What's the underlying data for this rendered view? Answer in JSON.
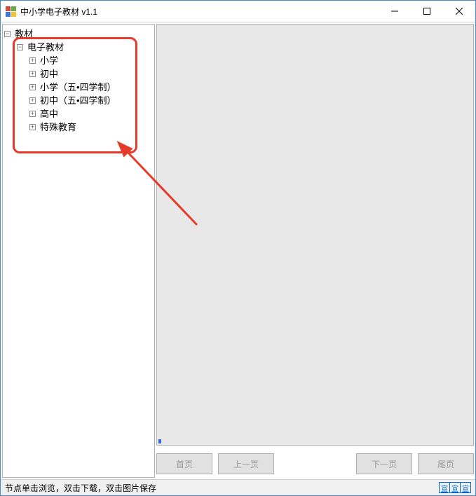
{
  "window": {
    "title": "中小学电子教材 v1.1"
  },
  "tree": {
    "root": {
      "label": "教材",
      "expanded": true,
      "children": [
        {
          "label": "电子教材",
          "expanded": true,
          "children": [
            {
              "label": "小学",
              "expanded": false
            },
            {
              "label": "初中",
              "expanded": false
            },
            {
              "label": "小学（五•四学制）",
              "expanded": false
            },
            {
              "label": "初中（五•四学制）",
              "expanded": false
            },
            {
              "label": "高中",
              "expanded": false
            },
            {
              "label": "特殊教育",
              "expanded": false
            }
          ]
        }
      ]
    }
  },
  "nav": {
    "first": "首页",
    "prev": "上一页",
    "next": "下一页",
    "last": "尾页"
  },
  "status": {
    "hint": "节点单击浏览，双击下载，双击图片保存",
    "link1": "宣",
    "link2": "宣",
    "link3": "宣"
  }
}
